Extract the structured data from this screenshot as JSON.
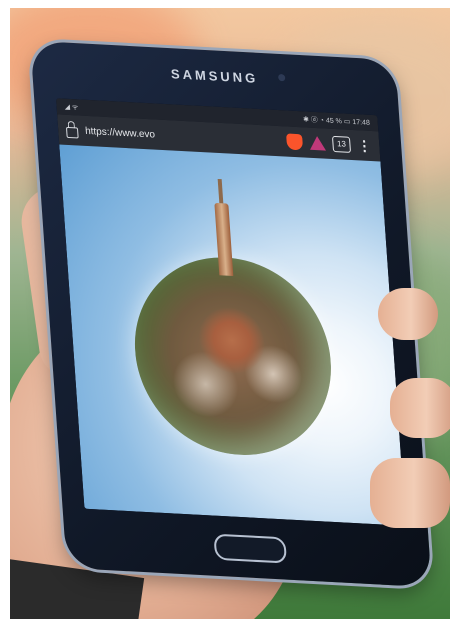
{
  "phone": {
    "brand": "SAMSUNG"
  },
  "statusbar": {
    "left": "◢ ᯤ",
    "right": "✱ ⓓ ◔ 45 % ▭ 17:48"
  },
  "browser": {
    "url": "https://www.evo",
    "tab_count": "13",
    "menu_glyph": "⋮"
  },
  "icons": {
    "lock": "lock-icon",
    "brave": "brave-shield-icon",
    "rewards": "brave-rewards-icon",
    "tabs": "tab-switcher-icon",
    "menu": "overflow-menu-icon"
  }
}
